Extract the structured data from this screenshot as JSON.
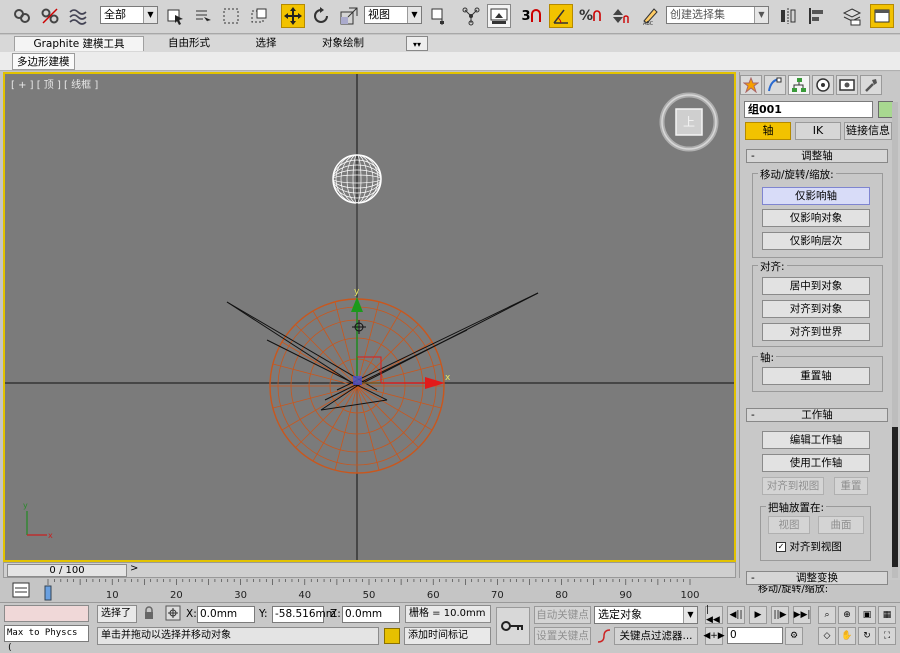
{
  "toolbar": {
    "selection_filter": "全部",
    "ref_coord": "视图",
    "snap_count": "3",
    "named_selection_placeholder": "创建选择集"
  },
  "ribbon": {
    "tabs": [
      "Graphite 建模工具",
      "自由形式",
      "选择",
      "对象绘制"
    ],
    "sub_tab": "多边形建模"
  },
  "viewport": {
    "label": "[ + ] [ 顶 ] [ 线框 ]",
    "cube_face": "上",
    "gizmo": {
      "y_label": "y",
      "x_label": "x"
    },
    "axis_tripod": {
      "y": "y",
      "x": "x"
    }
  },
  "panel": {
    "object_name": "组001",
    "object_color": "#a8d890",
    "sub_tabs": [
      "轴",
      "IK",
      "链接信息"
    ],
    "adjust_pivot": {
      "title": "调整轴",
      "move_group": "移动/旋转/缩放:",
      "move_buttons": [
        "仅影响轴",
        "仅影响对象",
        "仅影响层次"
      ],
      "align_group": "对齐:",
      "align_buttons": [
        "居中到对象",
        "对齐到对象",
        "对齐到世界"
      ],
      "pivot_group": "轴:",
      "reset_button": "重置轴"
    },
    "working_pivot": {
      "title": "工作轴",
      "edit": "编辑工作轴",
      "use": "使用工作轴",
      "align_view": "对齐到视图",
      "reset": "重置",
      "place_group": "把轴放置在:",
      "view": "视图",
      "surface": "曲面",
      "align_checkbox": "对齐到视图"
    },
    "adjust_transform": {
      "title": "调整变换",
      "next": "移动/旋转/缩放:"
    }
  },
  "timeline": {
    "frame": "0 / 100",
    "ticks": [
      "0",
      "10",
      "20",
      "30",
      "40",
      "50",
      "60",
      "70",
      "80",
      "90",
      "100"
    ]
  },
  "status": {
    "script_listener": "Max to Physcs (",
    "selected": "选择了",
    "x_label": "X:",
    "x_value": "0.0mm",
    "y_label": "Y:",
    "y_value": "-58.516mm",
    "z_label": "Z:",
    "z_value": "0.0mm",
    "grid": "栅格 = 10.0mm",
    "prompt": "单击并拖动以选择并移动对象",
    "add_time_tag": "添加时间标记",
    "auto_key": "自动关键点",
    "set_key": "设置关键点",
    "key_mode": "选定对象",
    "key_filter": "关键点过滤器...",
    "current_frame": "0"
  }
}
